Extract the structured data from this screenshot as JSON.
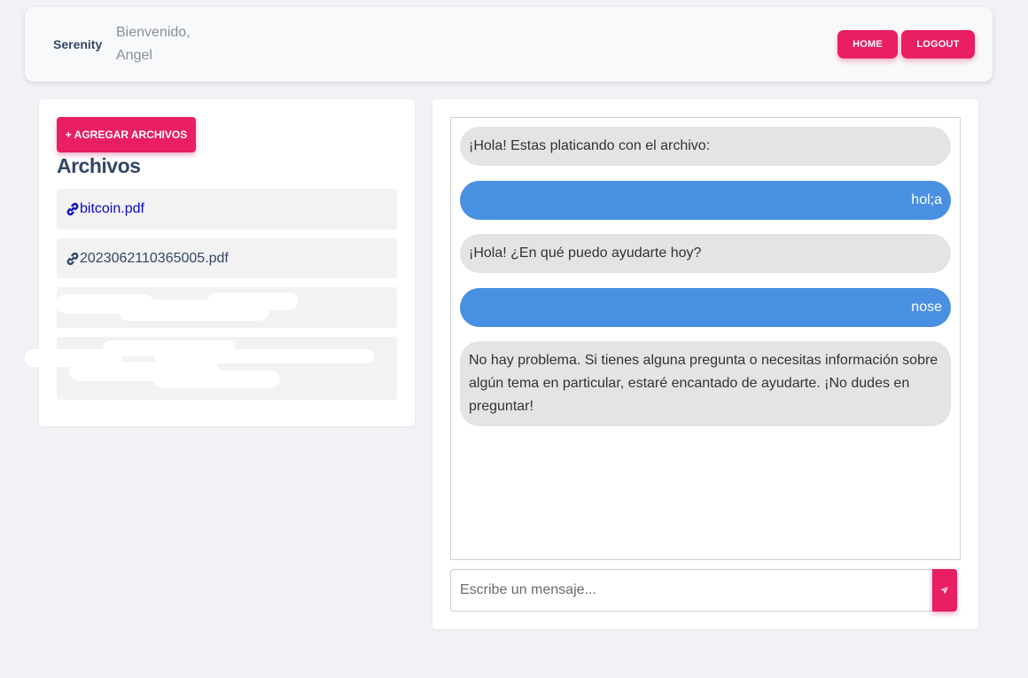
{
  "header": {
    "brand": "Serenity",
    "welcome": "Bienvenido, Angel",
    "home_label": "HOME",
    "logout_label": "LOGOUT"
  },
  "files": {
    "add_label": "+ AGREGAR ARCHIVOS",
    "title": "Archivos",
    "items": [
      {
        "name": "bitcoin.pdf",
        "icon": "link-icon"
      },
      {
        "name": "2023062110365005.pdf",
        "icon": "link-icon"
      }
    ]
  },
  "chat": {
    "messages": [
      {
        "role": "bot",
        "text": "¡Hola! Estas platicando con el archivo:"
      },
      {
        "role": "user",
        "text": "hol;a"
      },
      {
        "role": "bot",
        "text": "¡Hola! ¿En qué puedo ayudarte hoy?"
      },
      {
        "role": "user",
        "text": "nose"
      },
      {
        "role": "bot",
        "text": "No hay problema. Si tienes alguna pregunta o necesitas información sobre algún tema en particular, estaré encantado de ayudarte. ¡No dudes en preguntar!"
      }
    ],
    "input_placeholder": "Escribe un mensaje...",
    "input_value": "",
    "send_icon": "send-icon"
  },
  "colors": {
    "accent": "#e91e63",
    "user_bubble": "#4a90e2",
    "bot_bubble": "#e4e4e4",
    "link": "#0d0dcc"
  }
}
